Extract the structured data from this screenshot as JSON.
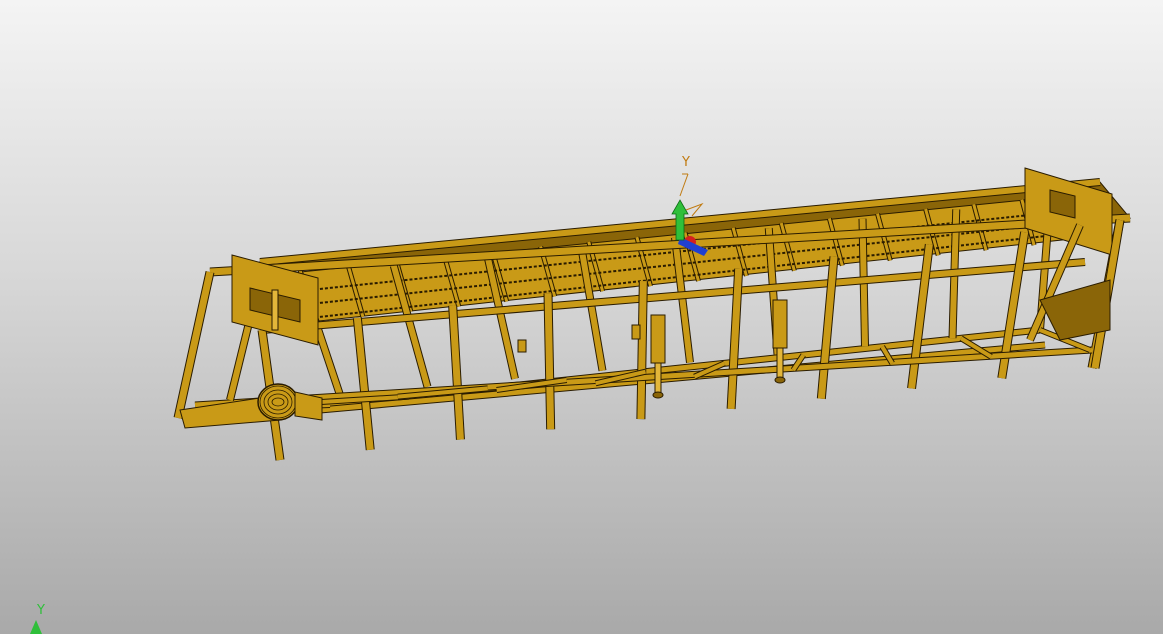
{
  "viewport": {
    "background_top": "#f4f4f4",
    "background_bottom": "#a9a9a9"
  },
  "model": {
    "color_fill": "#c99a17",
    "color_dark": "#8a6508",
    "color_edge": "#2a1c00",
    "color_light": "#e3b63a"
  },
  "triad": {
    "y_label": "Y",
    "y_color": "#2fbf3a",
    "x_color": "#d42020",
    "z_color": "#2040d0",
    "label_color": "#c07a10"
  },
  "corner_triad": {
    "y_label": "Y",
    "y_color": "#2fbf3a"
  }
}
